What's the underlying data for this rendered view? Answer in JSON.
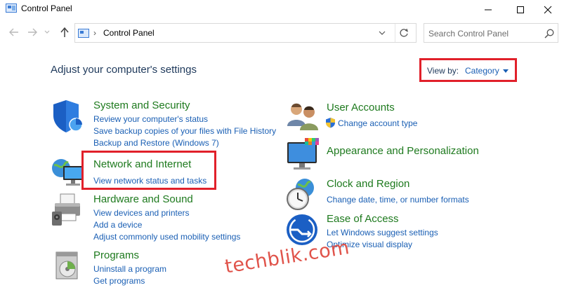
{
  "window": {
    "title": "Control Panel"
  },
  "address": {
    "crumb": "Control Panel"
  },
  "search": {
    "placeholder": "Search Control Panel"
  },
  "heading": "Adjust your computer's settings",
  "view_by": {
    "label": "View by:",
    "value": "Category"
  },
  "categories_left": [
    {
      "title": "System and Security",
      "links": [
        "Review your computer's status",
        "Save backup copies of your files with File History",
        "Backup and Restore (Windows 7)"
      ]
    },
    {
      "title": "Network and Internet",
      "links": [
        "View network status and tasks"
      ]
    },
    {
      "title": "Hardware and Sound",
      "links": [
        "View devices and printers",
        "Add a device",
        "Adjust commonly used mobility settings"
      ]
    },
    {
      "title": "Programs",
      "links": [
        "Uninstall a program",
        "Get programs"
      ]
    }
  ],
  "categories_right": [
    {
      "title": "User Accounts",
      "links": [
        "Change account type"
      ]
    },
    {
      "title": "Appearance and Personalization",
      "links": []
    },
    {
      "title": "Clock and Region",
      "links": [
        "Change date, time, or number formats"
      ]
    },
    {
      "title": "Ease of Access",
      "links": [
        "Let Windows suggest settings",
        "Optimize visual display"
      ]
    }
  ],
  "watermark": "techblik.com",
  "colors": {
    "title_green": "#1e7a1e",
    "link_blue": "#1a5fb4",
    "highlight_red": "#e1202a",
    "heading_navy": "#1e395b"
  }
}
